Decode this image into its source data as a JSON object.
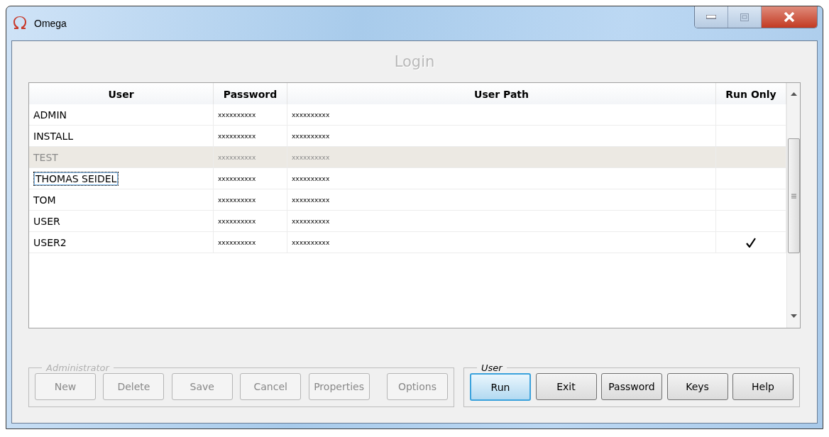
{
  "window": {
    "title": "Omega"
  },
  "heading": "Login",
  "table": {
    "columns": [
      "User",
      "Password",
      "User Path",
      "Run Only"
    ],
    "rows": [
      {
        "user": "ADMIN",
        "password": "xxxxxxxxxx",
        "user_path": "xxxxxxxxxx",
        "run_only": false,
        "selected": false,
        "focused": false
      },
      {
        "user": "INSTALL",
        "password": "xxxxxxxxxx",
        "user_path": "xxxxxxxxxx",
        "run_only": false,
        "selected": false,
        "focused": false
      },
      {
        "user": "TEST",
        "password": "xxxxxxxxxx",
        "user_path": "xxxxxxxxxx",
        "run_only": false,
        "selected": true,
        "focused": false
      },
      {
        "user": "THOMAS SEIDEL",
        "password": "xxxxxxxxxx",
        "user_path": "xxxxxxxxxx",
        "run_only": false,
        "selected": false,
        "focused": true
      },
      {
        "user": "TOM",
        "password": "xxxxxxxxxx",
        "user_path": "xxxxxxxxxx",
        "run_only": false,
        "selected": false,
        "focused": false
      },
      {
        "user": "USER",
        "password": "xxxxxxxxxx",
        "user_path": "xxxxxxxxxx",
        "run_only": false,
        "selected": false,
        "focused": false
      },
      {
        "user": "USER2",
        "password": "xxxxxxxxxx",
        "user_path": "xxxxxxxxxx",
        "run_only": true,
        "selected": false,
        "focused": false
      }
    ]
  },
  "groups": [
    {
      "title": "Administrator",
      "disabled": true,
      "buttons": [
        {
          "label": "New",
          "default": false
        },
        {
          "label": "Delete",
          "default": false
        },
        {
          "label": "Save",
          "default": false
        },
        {
          "label": "Cancel",
          "default": false
        },
        {
          "label": "Properties",
          "default": false
        },
        {
          "label": "Options",
          "default": false
        }
      ]
    },
    {
      "title": "User",
      "disabled": false,
      "buttons": [
        {
          "label": "Run",
          "default": true
        },
        {
          "label": "Exit",
          "default": false
        },
        {
          "label": "Password",
          "default": false
        },
        {
          "label": "Keys",
          "default": false
        },
        {
          "label": "Help",
          "default": false
        }
      ]
    }
  ]
}
